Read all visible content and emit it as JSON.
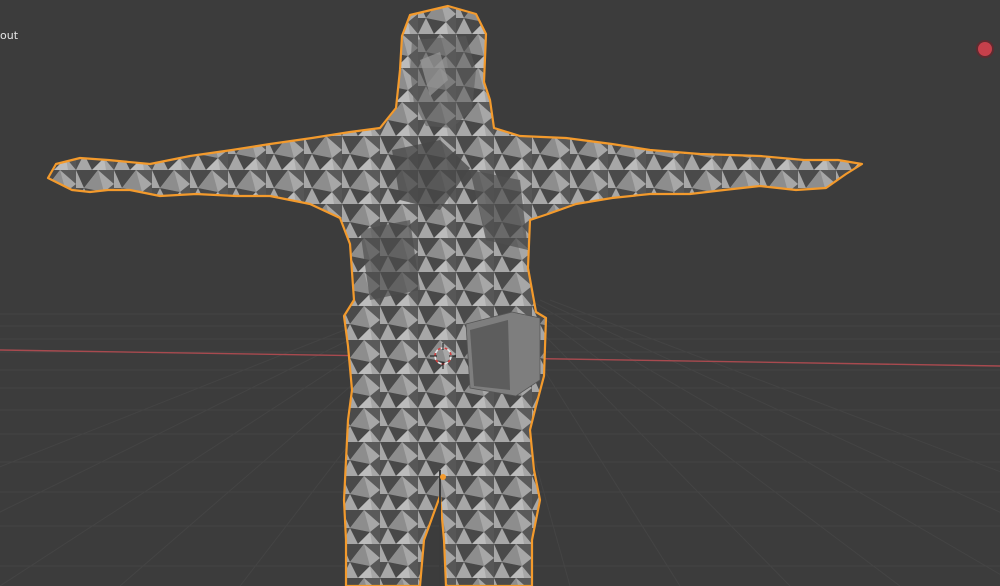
{
  "header": {
    "mode_label_partial": "out"
  },
  "colors": {
    "background": "#3c3c3c",
    "grid": "#454545",
    "x_axis": "#a84a4f",
    "y_axis": "#6f9a2f",
    "outline": "#f39a2c",
    "mesh_light": "#a8a8a8",
    "mesh_dark": "#494949",
    "record": "#c7404b"
  },
  "icons": {
    "record": "record-dot-icon",
    "cursor": "3d-cursor-icon"
  }
}
